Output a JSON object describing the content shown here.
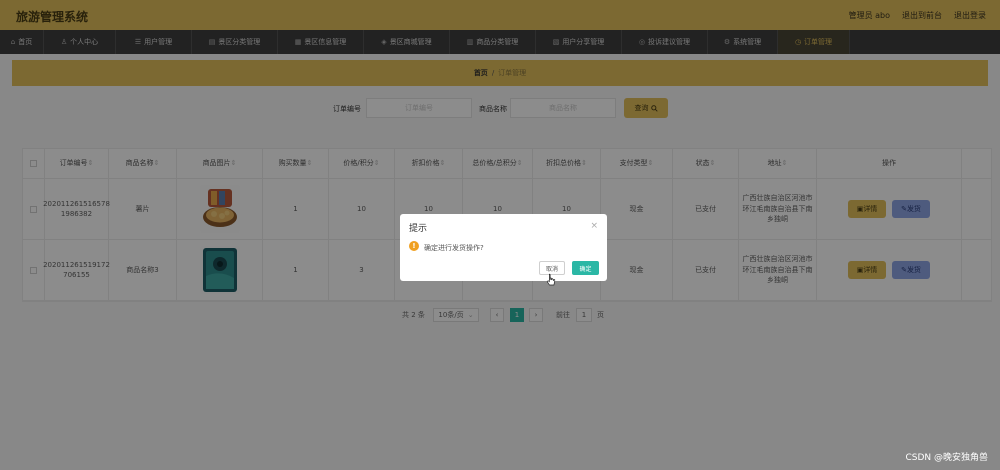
{
  "header": {
    "title": "旅游管理系统",
    "links": [
      "管理员 abo",
      "退出到前台",
      "退出登录"
    ]
  },
  "nav": {
    "items": [
      {
        "icon": "⌂",
        "label": "首页"
      },
      {
        "icon": "♙",
        "label": "个人中心"
      },
      {
        "icon": "☰",
        "label": "用户管理"
      },
      {
        "icon": "▤",
        "label": "景区分类管理"
      },
      {
        "icon": "▦",
        "label": "景区信息管理"
      },
      {
        "icon": "◈",
        "label": "景区商城管理"
      },
      {
        "icon": "▥",
        "label": "商品分类管理"
      },
      {
        "icon": "▧",
        "label": "用户分享管理"
      },
      {
        "icon": "◎",
        "label": "投诉建议管理"
      },
      {
        "icon": "⚙",
        "label": "系统管理"
      },
      {
        "icon": "◷",
        "label": "订单管理"
      }
    ],
    "active_index": 10
  },
  "breadcrumb": {
    "home": "首页",
    "separator": "/",
    "current": "订单管理"
  },
  "search": {
    "order_label": "订单编号",
    "order_placeholder": "订单编号",
    "product_label": "商品名称",
    "product_placeholder": "商品名称",
    "button_label": "查询",
    "button_icon": "search-icon"
  },
  "table": {
    "headers": [
      "订单编号",
      "商品名称",
      "商品图片",
      "购买数量",
      "价格/积分",
      "折扣价格",
      "总价格/总积分",
      "折扣总价格",
      "支付类型",
      "状态",
      "地址",
      "操作"
    ],
    "rows": [
      {
        "order_no": "202011261516578 1986382",
        "name": "薯片",
        "image": "chips-image",
        "qty": "1",
        "price": "10",
        "discount": "10",
        "total": "10",
        "discount_total": "10",
        "pay": "现金",
        "status": "已支付",
        "address": "广西壮族自治区河池市环江毛南族自治县下南乡独峒",
        "detail_label": "详情",
        "ship_label": "发货"
      },
      {
        "order_no": "202011261519172 706155",
        "name": "商品名称3",
        "image": "phone-image",
        "qty": "1",
        "price": "3",
        "discount": "",
        "total": "",
        "discount_total": "",
        "pay": "现金",
        "status": "已支付",
        "address": "广西壮族自治区河池市环江毛南族自治县下南乡独峒",
        "detail_label": "详情",
        "ship_label": "发货"
      }
    ]
  },
  "pagination": {
    "total": "共 2 条",
    "page_size": "10条/页",
    "prev": "‹",
    "current_page": "1",
    "next": "›",
    "goto_label": "前往",
    "goto_value": "1",
    "page_unit": "页"
  },
  "dialog": {
    "title": "提示",
    "message": "确定进行发货操作?",
    "cancel_label": "取消",
    "confirm_label": "确定",
    "close_icon": "×",
    "warning_icon": "!"
  },
  "watermark": "CSDN @晚安独角兽",
  "colors": {
    "accent": "#e2c05c",
    "nav_bg": "#3e3e3e",
    "primary_btn": "#2bb7a5",
    "ship_btn": "#8fa6e6"
  }
}
